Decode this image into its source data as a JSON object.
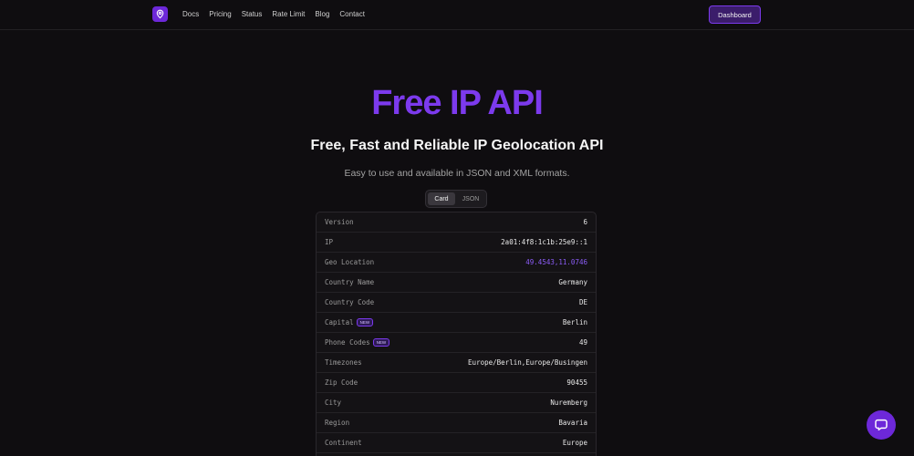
{
  "nav": {
    "links": [
      "Docs",
      "Pricing",
      "Status",
      "Rate Limit",
      "Blog",
      "Contact"
    ],
    "dashboard_label": "Dashboard"
  },
  "hero": {
    "title": "Free IP API",
    "subtitle": "Free, Fast and Reliable IP Geolocation API",
    "description": "Easy to use and available in JSON and XML formats."
  },
  "toggle": {
    "card_label": "Card",
    "json_label": "JSON",
    "selected": "Card"
  },
  "rows": [
    {
      "key": "Version",
      "value": "6"
    },
    {
      "key": "IP",
      "value": "2a01:4f8:1c1b:25e9::1"
    },
    {
      "key": "Geo Location",
      "value": "49.4543,11.0746"
    },
    {
      "key": "Country Name",
      "value": "Germany"
    },
    {
      "key": "Country Code",
      "value": "DE"
    },
    {
      "key": "Capital",
      "value": "Berlin",
      "badge": "NEW"
    },
    {
      "key": "Phone Codes",
      "value": "49",
      "badge": "NEW"
    },
    {
      "key": "Timezones",
      "value": "Europe/Berlin,Europe/Busingen"
    },
    {
      "key": "Zip Code",
      "value": "90455"
    },
    {
      "key": "City",
      "value": "Nuremberg"
    },
    {
      "key": "Region",
      "value": "Bavaria"
    },
    {
      "key": "Continent",
      "value": "Europe"
    }
  ],
  "colors": {
    "accent": "#7c3aed",
    "background": "#0f0d10"
  },
  "icons": {
    "logo": "location-pin-icon",
    "help": "chat-bubble-icon"
  }
}
